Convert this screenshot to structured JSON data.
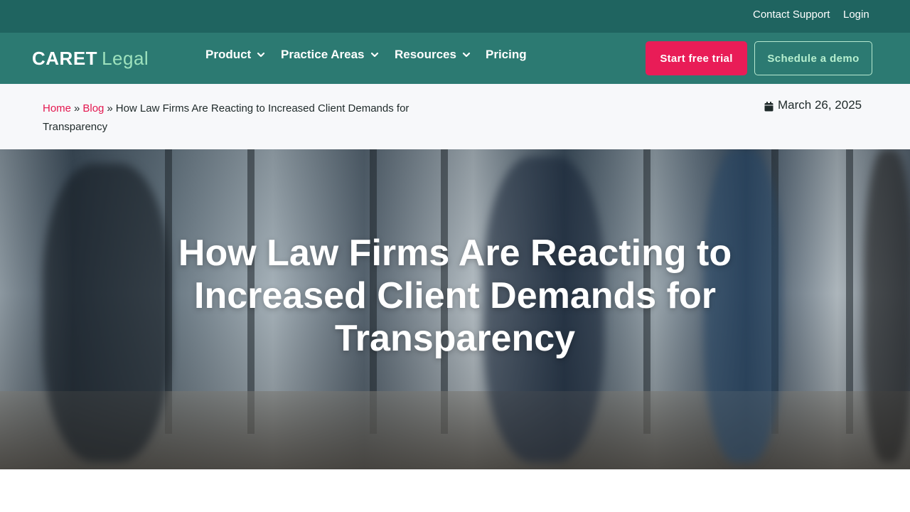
{
  "topbar": {
    "contact_label": "Contact Support",
    "login_label": "Login"
  },
  "header": {
    "logo_caret": "CARET",
    "logo_legal": "Legal",
    "nav": [
      {
        "label": "Product",
        "icon": "chevron-down-icon"
      },
      {
        "label": "Practice Areas",
        "icon": "chevron-down-icon"
      },
      {
        "label": "Resources",
        "icon": "chevron-down-icon"
      },
      {
        "label": "Pricing"
      }
    ],
    "trial_label": "Start free trial",
    "demo_label": "Schedule a demo"
  },
  "breadcrumb": {
    "home": "Home",
    "blog": "Blog",
    "separator": "»",
    "current": "How Law Firms Are Reacting to Increased Client Demands for Transparency"
  },
  "post": {
    "date": "March 26, 2025",
    "date_icon": "calendar-icon",
    "title": "How Law Firms Are Reacting to Increased Client Demands for Transparency"
  },
  "colors": {
    "topbar": "#1f6460",
    "navbar": "#2c7a72",
    "accent": "#e91c57",
    "logo_accent": "#9ee2bd"
  }
}
